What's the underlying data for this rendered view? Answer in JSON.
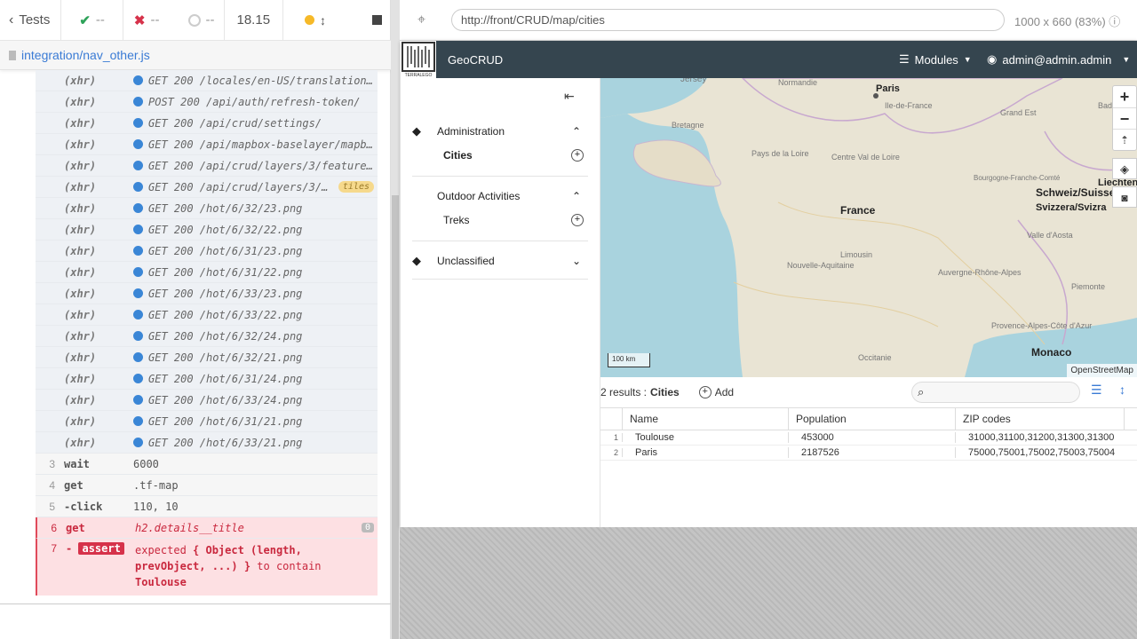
{
  "runner": {
    "back_label": "Tests",
    "passed": "--",
    "failed": "--",
    "pending": "--",
    "duration": "18.15",
    "spec_file": "integration/nav_other.js"
  },
  "log": [
    {
      "num": "",
      "name": "(xhr)",
      "msg": "GET 200 /locales/en-US/translation…",
      "badge": ""
    },
    {
      "num": "",
      "name": "(xhr)",
      "msg": "POST 200 /api/auth/refresh-token/",
      "badge": ""
    },
    {
      "num": "",
      "name": "(xhr)",
      "msg": "GET 200 /api/crud/settings/",
      "badge": ""
    },
    {
      "num": "",
      "name": "(xhr)",
      "msg": "GET 200 /api/mapbox-baselayer/mapb…",
      "badge": ""
    },
    {
      "num": "",
      "name": "(xhr)",
      "msg": "GET 200 /api/crud/layers/3/feature…",
      "badge": ""
    },
    {
      "num": "",
      "name": "(xhr)",
      "msg": "GET 200 /api/crud/layers/3/ti…",
      "badge": "tiles"
    },
    {
      "num": "",
      "name": "(xhr)",
      "msg": "GET 200 /hot/6/32/23.png",
      "badge": ""
    },
    {
      "num": "",
      "name": "(xhr)",
      "msg": "GET 200 /hot/6/32/22.png",
      "badge": ""
    },
    {
      "num": "",
      "name": "(xhr)",
      "msg": "GET 200 /hot/6/31/23.png",
      "badge": ""
    },
    {
      "num": "",
      "name": "(xhr)",
      "msg": "GET 200 /hot/6/31/22.png",
      "badge": ""
    },
    {
      "num": "",
      "name": "(xhr)",
      "msg": "GET 200 /hot/6/33/23.png",
      "badge": ""
    },
    {
      "num": "",
      "name": "(xhr)",
      "msg": "GET 200 /hot/6/33/22.png",
      "badge": ""
    },
    {
      "num": "",
      "name": "(xhr)",
      "msg": "GET 200 /hot/6/32/24.png",
      "badge": ""
    },
    {
      "num": "",
      "name": "(xhr)",
      "msg": "GET 200 /hot/6/32/21.png",
      "badge": ""
    },
    {
      "num": "",
      "name": "(xhr)",
      "msg": "GET 200 /hot/6/31/24.png",
      "badge": ""
    },
    {
      "num": "",
      "name": "(xhr)",
      "msg": "GET 200 /hot/6/33/24.png",
      "badge": ""
    },
    {
      "num": "",
      "name": "(xhr)",
      "msg": "GET 200 /hot/6/31/21.png",
      "badge": ""
    },
    {
      "num": "",
      "name": "(xhr)",
      "msg": "GET 200 /hot/6/33/21.png",
      "badge": ""
    }
  ],
  "commands": [
    {
      "num": "3",
      "name": "wait",
      "msg": "6000"
    },
    {
      "num": "4",
      "name": "get",
      "msg": ".tf-map"
    },
    {
      "num": "5",
      "name": "-click",
      "msg": "110, 10"
    }
  ],
  "fail": {
    "get_num": "6",
    "get_name": "get",
    "get_msg": "h2.details__title",
    "get_count": "0",
    "assert_num": "7",
    "assert_prefix": "-",
    "assert_name": "assert",
    "assert_line1": "expected",
    "assert_obj1": "{ Object (length,",
    "assert_obj2": "prevObject, ...) }",
    "assert_line2": "to contain",
    "assert_value": "Toulouse"
  },
  "browser": {
    "url": "http://front/CRUD/map/cities",
    "viewport": "1000 x 660",
    "scale": "(83%)"
  },
  "app": {
    "logo_text": "TERRALEGO",
    "name": "GeoCRUD",
    "modules_label": "Modules",
    "user_label": "admin@admin.admin",
    "groups": [
      {
        "label": "Administration",
        "items": [
          "Cities"
        ]
      },
      {
        "label": "Outdoor Activities",
        "items": [
          "Treks"
        ]
      },
      {
        "label": "Unclassified",
        "items": []
      }
    ],
    "map": {
      "labels": [
        "Jersey",
        "Paris",
        "Normandie",
        "Bretagne",
        "Pays de la Loire",
        "Centre Val de Loire",
        "Grand Est",
        "France",
        "Bourgogne-Franche-Comté",
        "Schweiz/Suisse",
        "Svizzera/Svizra",
        "Liechtenstein",
        "Nouvelle-Aquitaine",
        "Limousin",
        "Auvergne-Rhône-Alpes",
        "Occitanie",
        "Provence-Alpes-Côte d'Azur",
        "Monaco",
        "Valle d'Aosta",
        "Piemonte",
        "Ile-de-France",
        "Baden-Württemberg"
      ],
      "scale": "100 km",
      "attribution": "OpenStreetMap"
    },
    "results_count": "2 results :",
    "results_layer": "Cities",
    "add_label": "Add",
    "columns": [
      "Name",
      "Population",
      "ZIP codes"
    ],
    "rows": [
      {
        "index": "1",
        "name": "Toulouse",
        "population": "453000",
        "zip": "31000,31100,31200,31300,31300"
      },
      {
        "index": "2",
        "name": "Paris",
        "population": "2187526",
        "zip": "75000,75001,75002,75003,75004"
      }
    ]
  },
  "colors": {
    "header": "#35454f",
    "accent": "#3a7bd5",
    "fail": "#c9283e"
  }
}
